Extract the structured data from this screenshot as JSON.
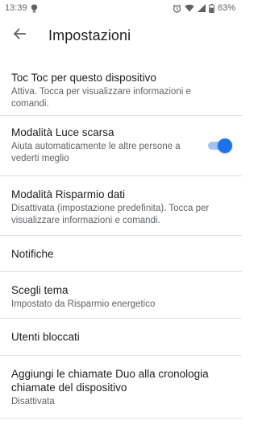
{
  "status_bar": {
    "time": "13:39",
    "battery": "63%",
    "icons": [
      "lightbulb-icon",
      "alarm-icon",
      "wifi-icon",
      "signal-icon",
      "battery-icon"
    ]
  },
  "app_bar": {
    "title": "Impostazioni",
    "back_icon": "arrow-back-icon"
  },
  "settings": {
    "toctoc": {
      "title": "Toc Toc per questo dispositivo",
      "subtitle": "Attiva. Tocca per visualizzare informazioni e comandi."
    },
    "luce": {
      "title": "Modalità Luce scarsa",
      "subtitle": "Aiuta automaticamente le altre persone a vederti meglio",
      "toggle_on": true
    },
    "risparmio": {
      "title": "Modalità Risparmio dati",
      "subtitle": "Disattivata (impostazione predefinita). Tocca per visualizzare informazioni e comandi."
    },
    "notifiche": {
      "title": "Notifiche"
    },
    "tema": {
      "title": "Scegli tema",
      "subtitle": "Impostato da Risparmio energetico"
    },
    "utenti": {
      "title": "Utenti bloccati"
    },
    "duo": {
      "title": "Aggiungi le chiamate Duo alla cronologia chiamate del dispositivo",
      "subtitle": "Disattivata"
    }
  },
  "colors": {
    "accent": "#1a73e8",
    "accent_track": "#a4c2f4",
    "divider": "#e0e0e0",
    "secondary_text": "#5f6368"
  }
}
